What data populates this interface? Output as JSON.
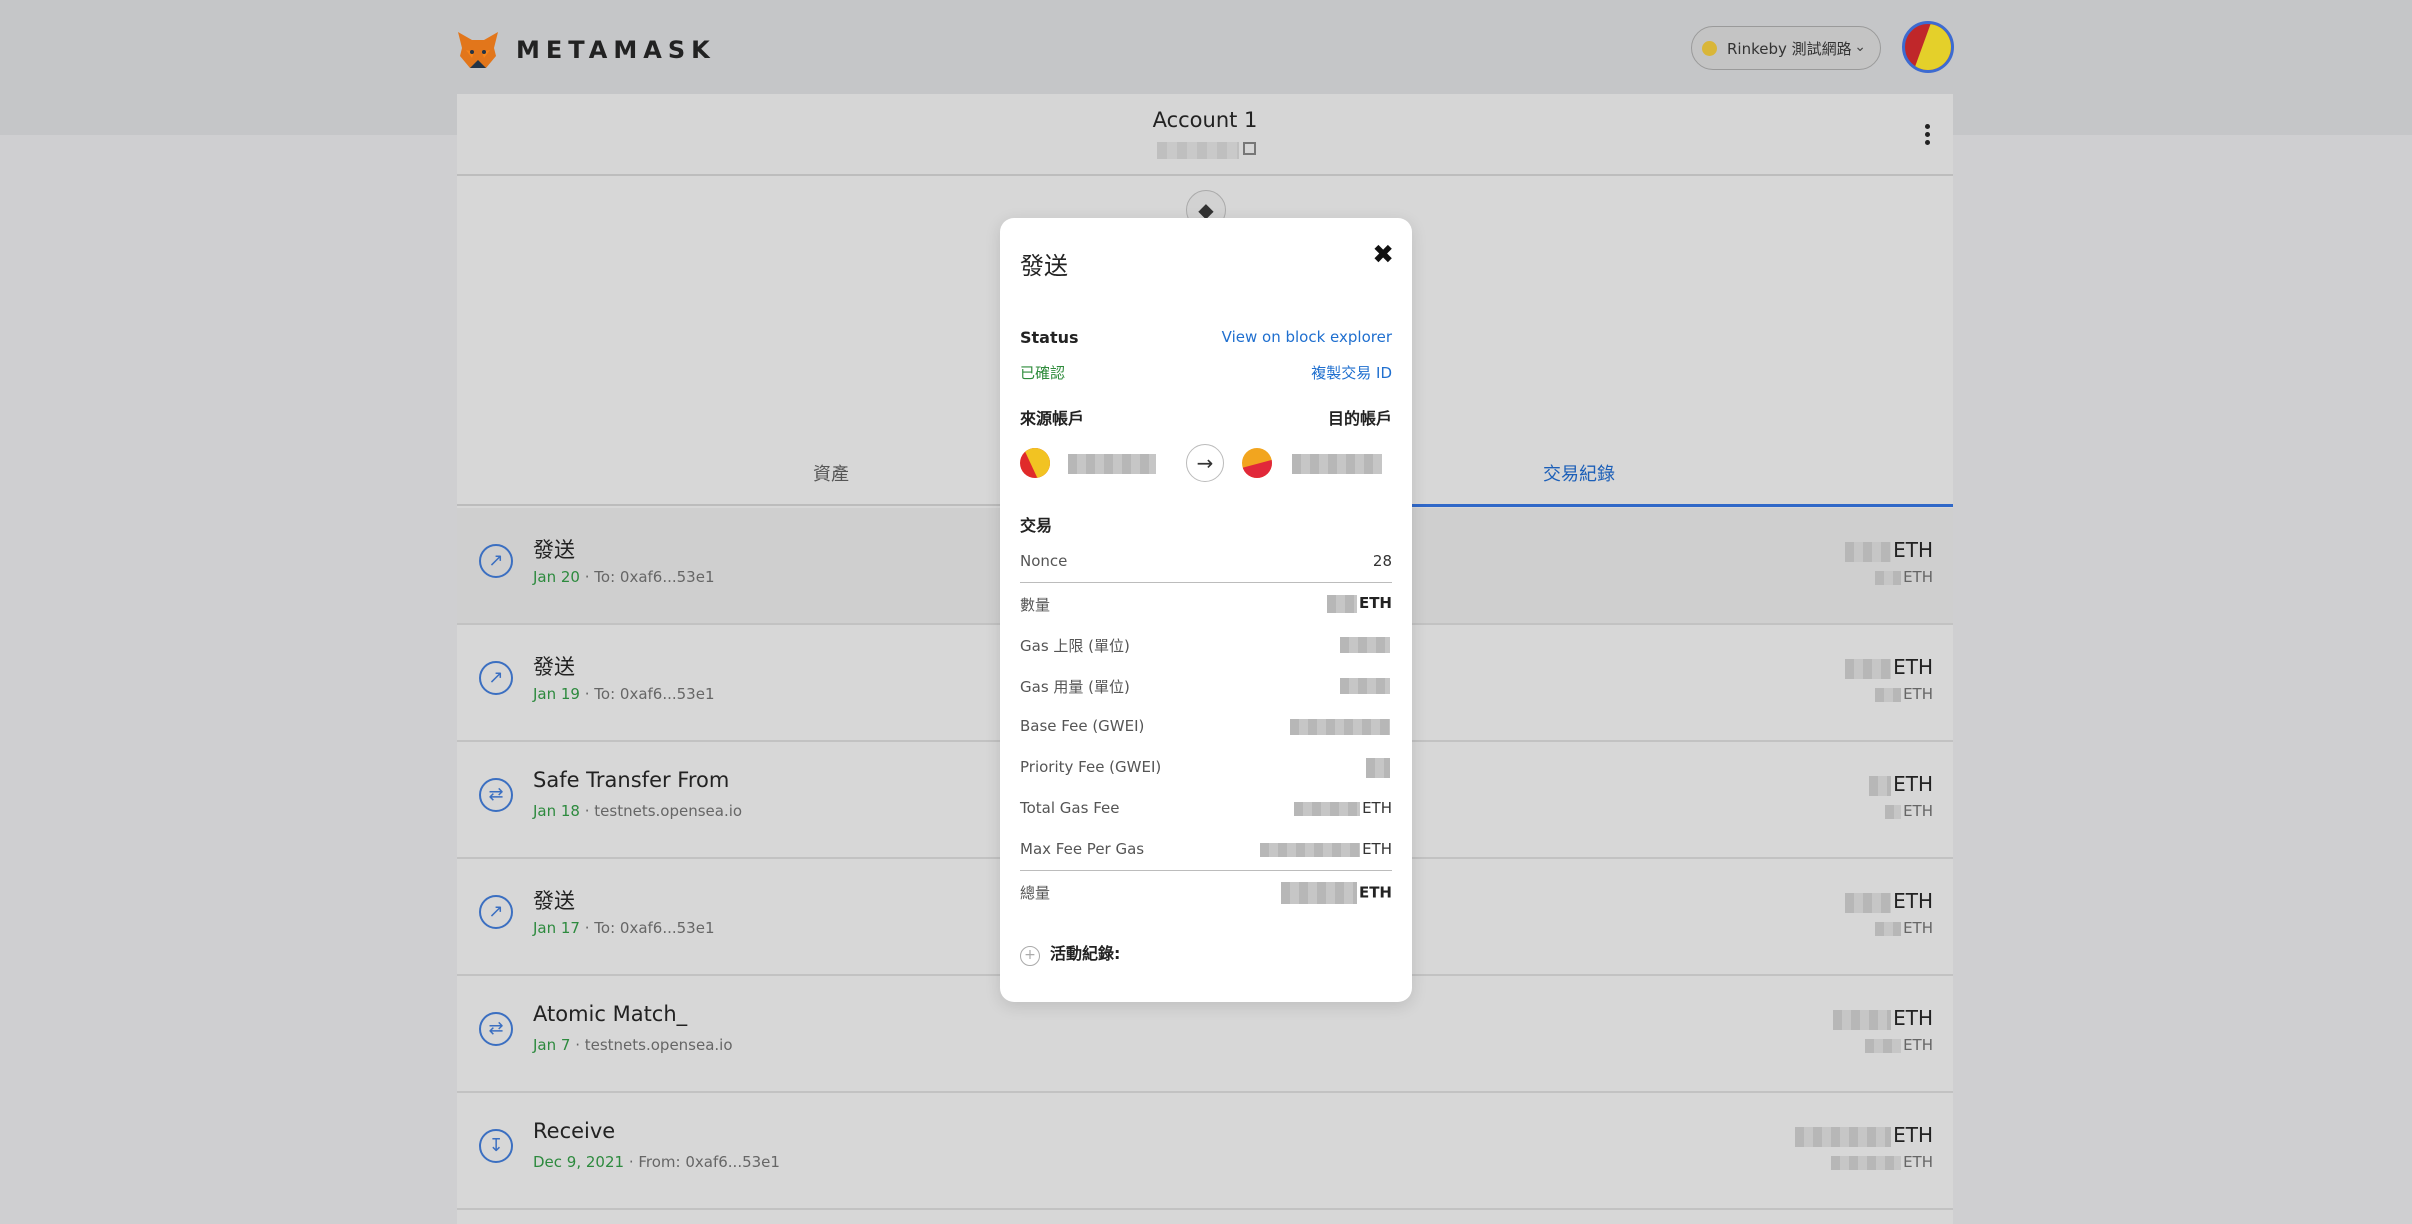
{
  "app": {
    "name": "METAMASK"
  },
  "network": {
    "label": "Rinkeby 測試網路"
  },
  "account": {
    "name": "Account 1"
  },
  "tabs": {
    "assets": "資產",
    "activity": "交易紀錄"
  },
  "transactions": [
    {
      "title": "發送",
      "date": "Jan 20",
      "detail": " · To: 0xaf6...53e1",
      "unit": "ETH",
      "sub_unit": "ETH"
    },
    {
      "title": "發送",
      "date": "Jan 19",
      "detail": " · To: 0xaf6...53e1",
      "unit": "ETH",
      "sub_unit": "ETH"
    },
    {
      "title": "Safe Transfer From",
      "date": "Jan 18",
      "detail": " · testnets.opensea.io",
      "unit": "ETH",
      "sub_unit": "ETH"
    },
    {
      "title": "發送",
      "date": "Jan 17",
      "detail": " · To: 0xaf6...53e1",
      "unit": "ETH",
      "sub_unit": "ETH"
    },
    {
      "title": "Atomic Match_",
      "date": "Jan 7",
      "detail": " · testnets.opensea.io",
      "unit": "ETH",
      "sub_unit": "ETH"
    },
    {
      "title": "Receive",
      "date": "Dec 9, 2021",
      "detail": " · From: 0xaf6...53e1",
      "unit": "ETH",
      "sub_unit": "ETH"
    }
  ],
  "modal": {
    "title": "發送",
    "status_label": "Status",
    "explorer_link": "View on block explorer",
    "status_value": "已確認",
    "copy_tx_id": "複製交易 ID",
    "from_label": "來源帳戶",
    "to_label": "目的帳戶",
    "section_title": "交易",
    "nonce_label": "Nonce",
    "nonce_value": "28",
    "amount_label": "數量",
    "amount_unit": "ETH",
    "gas_limit_label": "Gas 上限 (單位)",
    "gas_used_label": "Gas 用量 (單位)",
    "base_fee_label": "Base Fee (GWEI)",
    "priority_fee_label": "Priority Fee (GWEI)",
    "total_gas_label": "Total Gas Fee",
    "total_gas_unit": "ETH",
    "max_fee_label": "Max Fee Per Gas",
    "max_fee_unit": "ETH",
    "total_label": "總量",
    "total_unit": "ETH",
    "activity_log": "活動紀錄:"
  },
  "icons": {
    "send": "arrow-up-right-icon",
    "interaction": "swap-icon",
    "receive": "download-icon",
    "close": "close-icon",
    "copy": "copy-icon",
    "menu": "kebab-menu-icon"
  }
}
